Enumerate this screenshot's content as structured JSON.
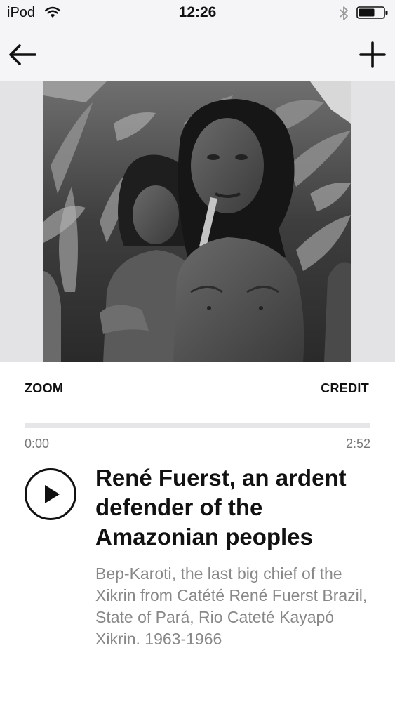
{
  "status_bar": {
    "carrier": "iPod",
    "time": "12:26",
    "icons": [
      "wifi-icon",
      "bluetooth-icon",
      "battery-icon"
    ]
  },
  "nav": {
    "back_icon": "arrow-left-icon",
    "add_icon": "plus-icon"
  },
  "photo": {
    "kind": "black-and-white photograph of two Kayapó Xikrin men standing in front of tall plants"
  },
  "actions": {
    "zoom_label": "ZOOM",
    "credit_label": "CREDIT"
  },
  "player": {
    "current_time": "0:00",
    "total_time": "2:52",
    "progress_fraction": 0,
    "play_icon": "play-icon"
  },
  "track": {
    "title": "René Fuerst, an ardent defender of the Amazonian peoples",
    "description": "Bep-Karoti, the last big chief of the Xikrin from Catété René Fuerst Brazil, State of Pará, Rio Cateté Kayapó Xikrin. 1963-1966"
  },
  "colors": {
    "bar_background": "#f5f4f7",
    "photo_background": "#e3e3e5",
    "text_primary": "#111111",
    "text_secondary": "#888888",
    "progress_track": "#e6e6e8"
  }
}
